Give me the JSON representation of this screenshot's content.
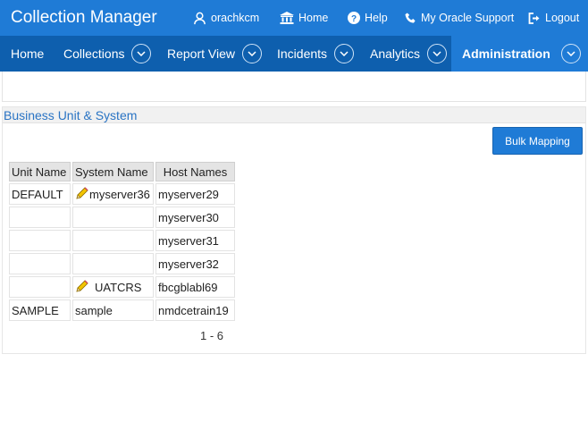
{
  "header": {
    "app_title": "Collection Manager",
    "links": [
      {
        "label": "orachkcm",
        "icon": "user-icon"
      },
      {
        "label": "Home",
        "icon": "home-icon"
      },
      {
        "label": "Help",
        "icon": "help-icon"
      },
      {
        "label": "My Oracle Support",
        "icon": "phone-icon"
      },
      {
        "label": "Logout",
        "icon": "logout-icon"
      }
    ]
  },
  "nav": {
    "items": [
      {
        "label": "Home"
      },
      {
        "label": "Collections"
      },
      {
        "label": "Report View"
      },
      {
        "label": "Incidents"
      },
      {
        "label": "Analytics"
      },
      {
        "label": "Administration"
      }
    ],
    "active": "Administration"
  },
  "region": {
    "title": "Business Unit & System",
    "bulk_button": "Bulk Mapping",
    "columns": [
      "Unit Name",
      "System Name",
      "Host Names"
    ],
    "rows": [
      {
        "unit": "DEFAULT",
        "system": "myserver36",
        "host": "myserver29",
        "editable": true
      },
      {
        "unit": "",
        "system": "",
        "host": "myserver30",
        "editable": false
      },
      {
        "unit": "",
        "system": "",
        "host": "myserver31",
        "editable": false
      },
      {
        "unit": "",
        "system": "",
        "host": "myserver32",
        "editable": false
      },
      {
        "unit": "",
        "system": "UATCRS",
        "host": "fbcgblabl69",
        "editable": true
      },
      {
        "unit": "SAMPLE",
        "system": "sample",
        "host": "nmdcetrain19",
        "editable": false
      }
    ],
    "pagination": "1 - 6"
  },
  "colors": {
    "header_bg": "#1f7bd6",
    "nav_bg": "#0e5fae",
    "active_nav_bg": "#1f7bd6",
    "region_title": "#2a74c4"
  }
}
